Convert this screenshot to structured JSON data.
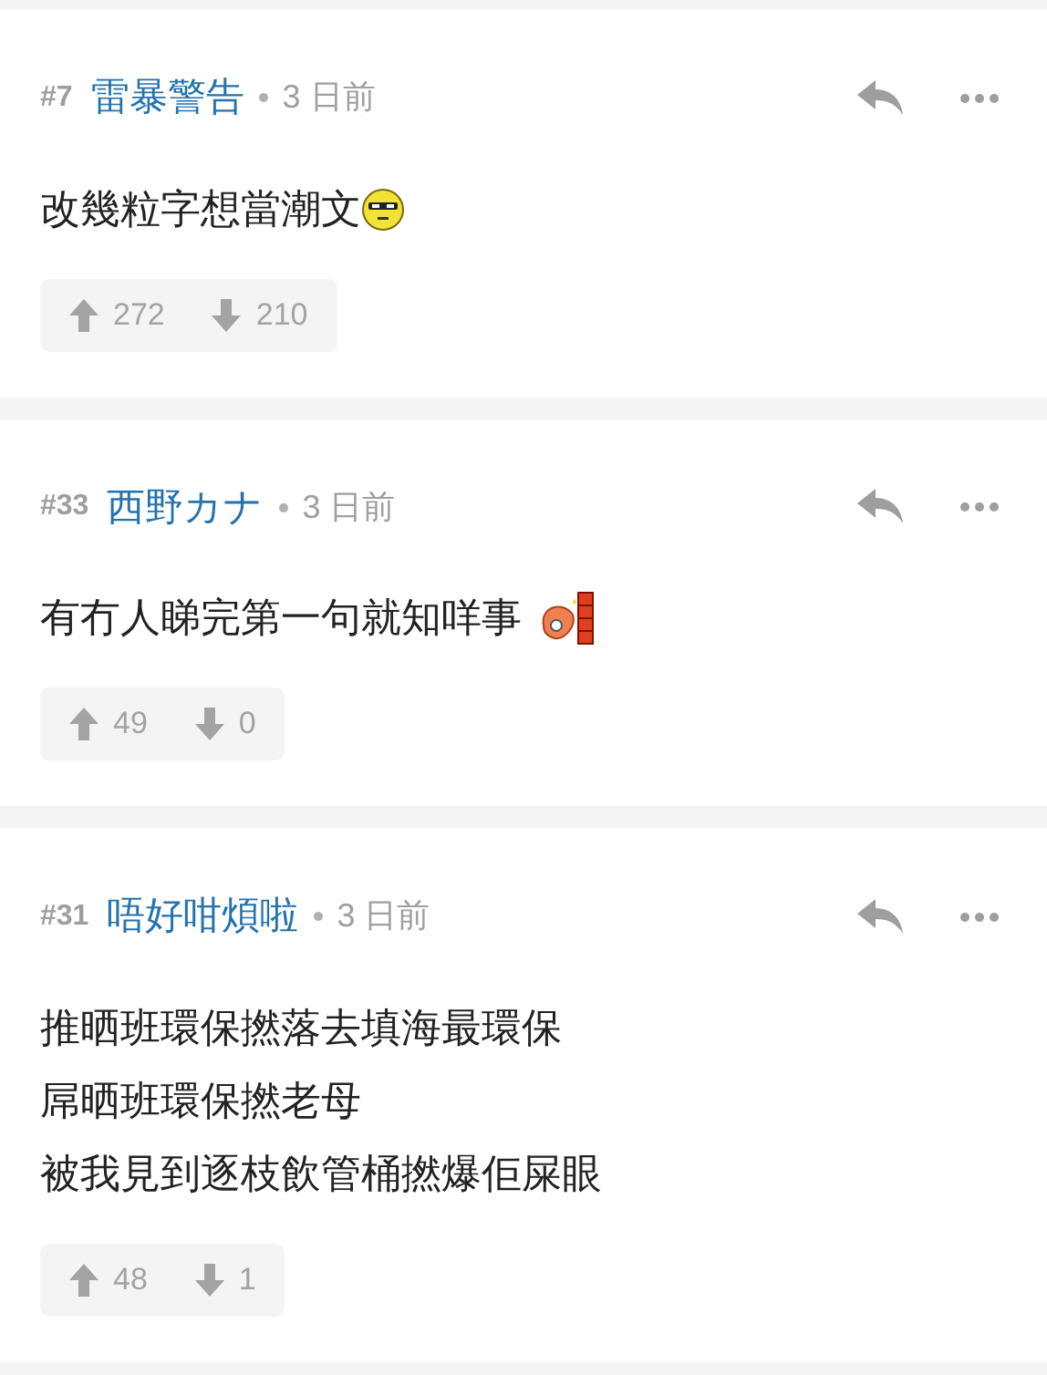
{
  "comments": [
    {
      "floor": "#7",
      "author": "雷暴警告",
      "time": "3 日前",
      "body": [
        "改幾粒字想當潮文"
      ],
      "emoticon": {
        "kind": "face"
      },
      "upvotes": "272",
      "downvotes": "210"
    },
    {
      "floor": "#33",
      "author": "西野カナ",
      "time": "3 日前",
      "body": [
        "有冇人睇完第一句就知咩事"
      ],
      "emoticon": {
        "kind": "shrimp"
      },
      "upvotes": "49",
      "downvotes": "0"
    },
    {
      "floor": "#31",
      "author": "唔好咁煩啦",
      "time": "3 日前",
      "body": [
        "推晒班環保撚落去填海最環保",
        "屌晒班環保撚老母",
        "被我見到逐枝飲管桶撚爆佢屎眼"
      ],
      "upvotes": "48",
      "downvotes": "1"
    }
  ]
}
